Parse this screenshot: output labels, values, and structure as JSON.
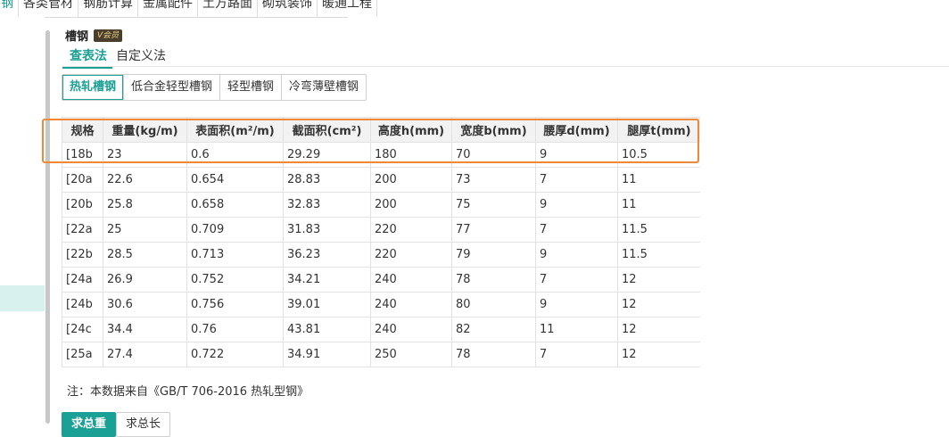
{
  "topnav": {
    "items": [
      "钢",
      "各类管材",
      "钢筋计算",
      "金属配件",
      "土方路面",
      "砌筑装饰",
      "暖通工程"
    ]
  },
  "header": {
    "title": "槽钢",
    "vip_badge": "V会员"
  },
  "mode_tabs": [
    "查表法",
    "自定义法"
  ],
  "type_tabs": [
    "热轧槽钢",
    "低合金轻型槽钢",
    "轻型槽钢",
    "冷弯薄壁槽钢"
  ],
  "table": {
    "columns": [
      "规格",
      "重量(kg/m)",
      "表面积(m²/m)",
      "截面积(cm²)",
      "高度h(mm)",
      "宽度b(mm)",
      "腰厚d(mm)",
      "腿厚t(mm)"
    ],
    "rows": [
      [
        "[18b",
        "23",
        "0.6",
        "29.29",
        "180",
        "70",
        "9",
        "10.5"
      ],
      [
        "[20a",
        "22.6",
        "0.654",
        "28.83",
        "200",
        "73",
        "7",
        "11"
      ],
      [
        "[20b",
        "25.8",
        "0.658",
        "32.83",
        "200",
        "75",
        "9",
        "11"
      ],
      [
        "[22a",
        "25",
        "0.709",
        "31.83",
        "220",
        "77",
        "7",
        "11.5"
      ],
      [
        "[22b",
        "28.5",
        "0.713",
        "36.23",
        "220",
        "79",
        "9",
        "11.5"
      ],
      [
        "[24a",
        "26.9",
        "0.752",
        "34.21",
        "240",
        "78",
        "7",
        "12"
      ],
      [
        "[24b",
        "30.6",
        "0.756",
        "39.01",
        "240",
        "80",
        "9",
        "12"
      ],
      [
        "[24c",
        "34.4",
        "0.76",
        "43.81",
        "240",
        "82",
        "11",
        "12"
      ],
      [
        "[25a",
        "27.4",
        "0.722",
        "34.91",
        "250",
        "78",
        "7",
        "12"
      ]
    ]
  },
  "note": "注：本数据来自《GB/T 706-2016 热轧型钢》",
  "calc_tabs": [
    "求总重",
    "求总长"
  ],
  "colors": {
    "accent": "#1aa094",
    "highlight_box": "#f0883a"
  }
}
